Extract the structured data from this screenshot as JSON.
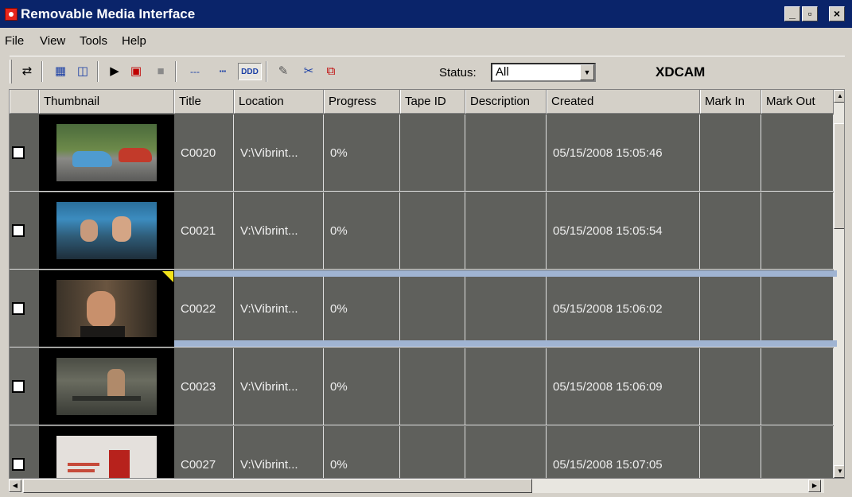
{
  "window": {
    "title": "Removable Media Interface",
    "minimize": "_",
    "maximize": "▫",
    "close": "×"
  },
  "menu": [
    "File",
    "View",
    "Tools",
    "Help"
  ],
  "toolbar": {
    "status_label": "Status:",
    "status_value": "All",
    "device": "XDCAM",
    "buttons": [
      {
        "name": "refresh-icon",
        "glyph": "⇄"
      },
      {
        "name": "details-view-icon",
        "glyph": "▦"
      },
      {
        "name": "columns-view-icon",
        "glyph": "◫"
      },
      {
        "name": "play-icon",
        "glyph": "▶"
      },
      {
        "name": "record-icon",
        "glyph": "▣"
      },
      {
        "name": "stop-icon",
        "glyph": "■"
      },
      {
        "name": "dashes-icon",
        "glyph": "---"
      },
      {
        "name": "small-thumbs-icon",
        "glyph": "▪▪▪"
      },
      {
        "name": "large-thumbs-icon",
        "glyph": "DDD"
      },
      {
        "name": "edit-icon",
        "glyph": "✎"
      },
      {
        "name": "scissors-icon",
        "glyph": "✂"
      },
      {
        "name": "copy-icon",
        "glyph": "⧉"
      }
    ]
  },
  "columns": [
    "Thumbnail",
    "Title",
    "Location",
    "Progress",
    "Tape ID",
    "Description",
    "Created",
    "Mark In",
    "Mark Out"
  ],
  "rows": [
    {
      "title": "C0020",
      "location": "V:\\Vibrint...",
      "progress": "0%",
      "tape_id": "",
      "description": "",
      "created": "05/15/2008 15:05:46",
      "mark_in": "",
      "mark_out": "",
      "selected": false
    },
    {
      "title": "C0021",
      "location": "V:\\Vibrint...",
      "progress": "0%",
      "tape_id": "",
      "description": "",
      "created": "05/15/2008 15:05:54",
      "mark_in": "",
      "mark_out": "",
      "selected": false
    },
    {
      "title": "C0022",
      "location": "V:\\Vibrint...",
      "progress": "0%",
      "tape_id": "",
      "description": "",
      "created": "05/15/2008 15:06:02",
      "mark_in": "",
      "mark_out": "",
      "selected": true
    },
    {
      "title": "C0023",
      "location": "V:\\Vibrint...",
      "progress": "0%",
      "tape_id": "",
      "description": "",
      "created": "05/15/2008 15:06:09",
      "mark_in": "",
      "mark_out": "",
      "selected": false
    },
    {
      "title": "C0027",
      "location": "V:\\Vibrint...",
      "progress": "0%",
      "tape_id": "",
      "description": "",
      "created": "05/15/2008 15:07:05",
      "mark_in": "",
      "mark_out": "",
      "selected": false
    }
  ],
  "colors": {
    "titlebar": "#0a246a",
    "grid_background": "#5f605c",
    "selection": "#a0b4d2",
    "flag": "#f2e21a"
  }
}
